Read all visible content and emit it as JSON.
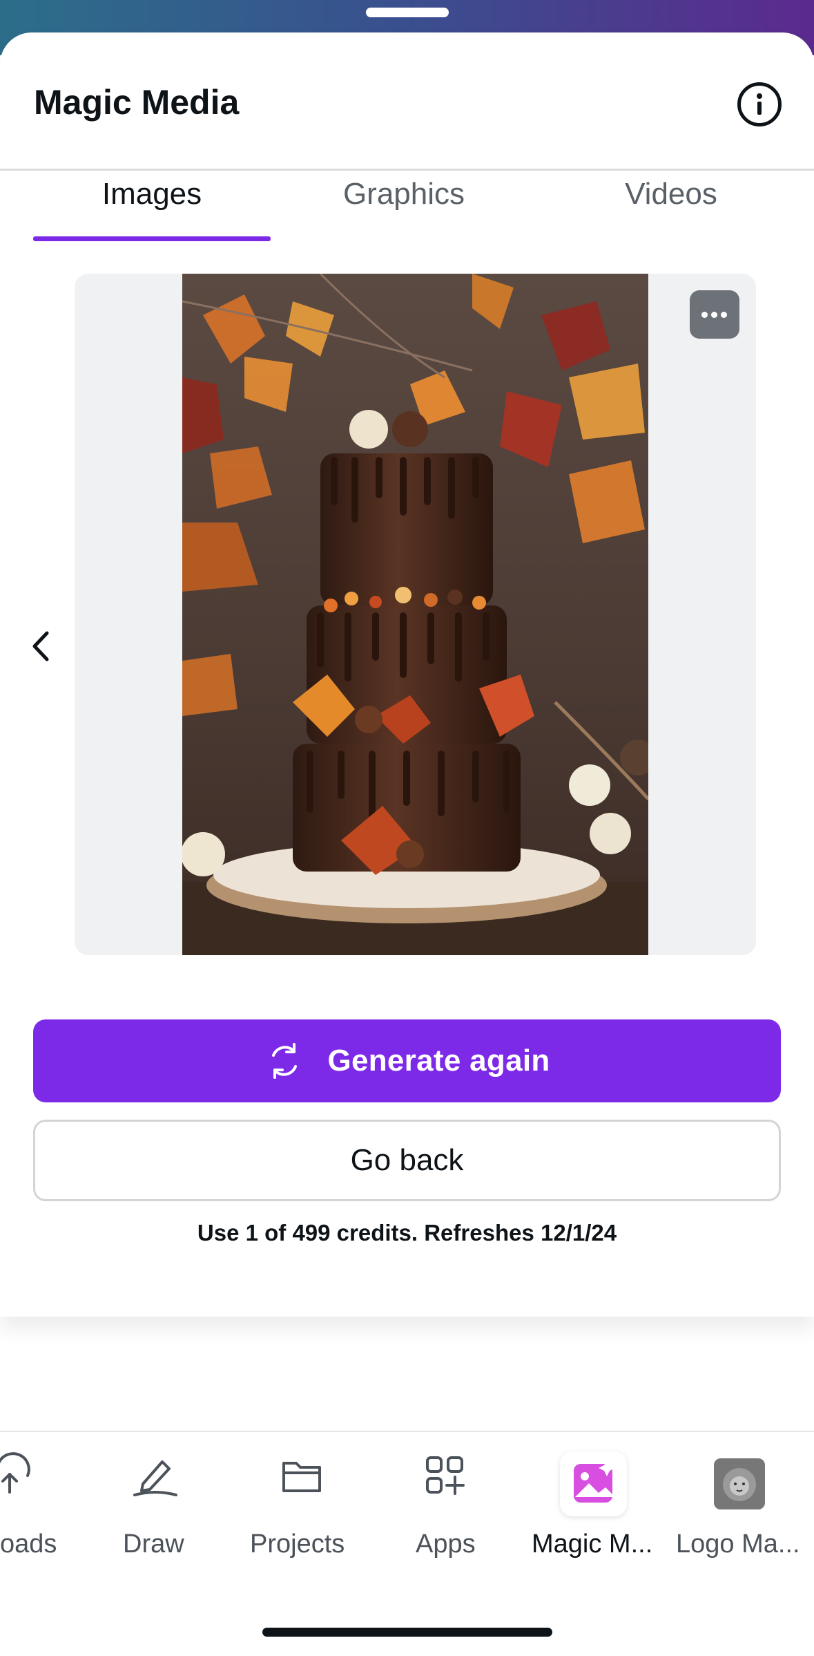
{
  "sheet": {
    "title": "Magic Media",
    "info_icon": "info-circle-icon"
  },
  "tabs": [
    {
      "label": "Images",
      "active": true
    },
    {
      "label": "Graphics",
      "active": false
    },
    {
      "label": "Videos",
      "active": false
    }
  ],
  "preview": {
    "more_icon": "ellipsis-icon",
    "prev_icon": "chevron-left-icon"
  },
  "actions": {
    "generate_label": "Generate again",
    "generate_icon": "refresh-icon",
    "back_label": "Go back",
    "credits_text": "Use 1 of 499 credits. Refreshes 12/1/24"
  },
  "bottom_nav": {
    "items": [
      {
        "label": "oads",
        "icon": "upload-cloud-icon"
      },
      {
        "label": "Draw",
        "icon": "pen-icon"
      },
      {
        "label": "Projects",
        "icon": "folder-icon"
      },
      {
        "label": "Apps",
        "icon": "apps-grid-icon"
      },
      {
        "label": "Magic M...",
        "icon": "magic-media-icon"
      },
      {
        "label": "Logo Ma...",
        "icon": "lion-logo-icon"
      }
    ]
  },
  "colors": {
    "accent": "#7d2ae8",
    "text": "#0e1318",
    "muted": "#5a6067"
  }
}
